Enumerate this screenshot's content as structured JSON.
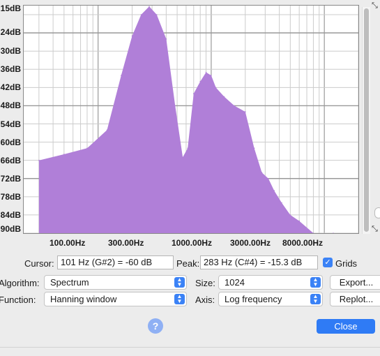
{
  "plot": {
    "y_labels": [
      "15dB",
      "24dB",
      "30dB",
      "36dB",
      "42dB",
      "48dB",
      "54dB",
      "60dB",
      "66dB",
      "72dB",
      "78dB",
      "84dB",
      "90dB"
    ],
    "x_labels": [
      "100.00Hz",
      "300.00Hz",
      "1000.00Hz",
      "3000.00Hz",
      "8000.00Hz"
    ],
    "fill_color": "#b07fd8",
    "grid_color": "#cccccc",
    "grid_major_color": "#999999"
  },
  "chart_data": {
    "type": "area",
    "x_scale": "log",
    "x": [
      30,
      50,
      80,
      120,
      160,
      200,
      240,
      283,
      330,
      400,
      480,
      560,
      620,
      700,
      800,
      900,
      1000,
      1100,
      1300,
      1600,
      2000,
      2400,
      2800,
      3200,
      3600,
      4200,
      5000,
      6000,
      8000,
      12000
    ],
    "y": [
      -66,
      -64,
      -62,
      -56,
      -38,
      -25,
      -18,
      -15.3,
      -18,
      -26,
      -48,
      -65,
      -62,
      -44,
      -40,
      -37,
      -38,
      -42,
      -45,
      -48,
      -50,
      -62,
      -70,
      -72,
      -76,
      -80,
      -84,
      -86,
      -90,
      -90
    ],
    "ylim": [
      -90,
      -15
    ],
    "grid": true
  },
  "controls": {
    "cursor_label": "Cursor:",
    "cursor_value": "101 Hz (G#2) = -60 dB",
    "peak_label": "Peak:",
    "peak_value": "283 Hz (C#4) = -15.3 dB",
    "grids_label": "Grids",
    "grids_checked": true,
    "algorithm_label": "Algorithm:",
    "algorithm_value": "Spectrum",
    "size_label": "Size:",
    "size_value": "1024",
    "export_label": "Export...",
    "function_label": "Function:",
    "function_value": "Hanning window",
    "axis_label": "Axis:",
    "axis_value": "Log frequency",
    "replot_label": "Replot...",
    "help_glyph": "?",
    "close_label": "Close"
  }
}
